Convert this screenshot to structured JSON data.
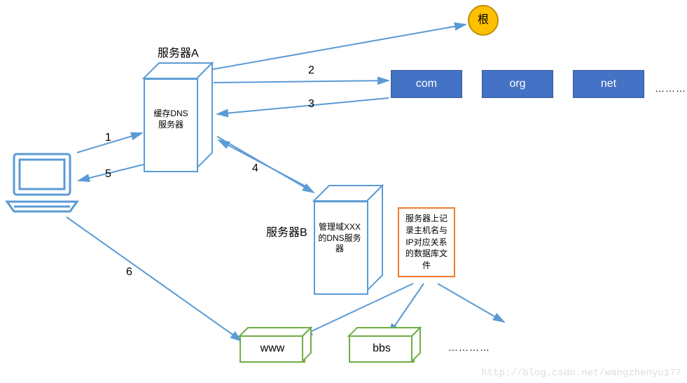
{
  "root": {
    "label": "根"
  },
  "serverA": {
    "title": "服务器A",
    "desc": "缓存DNS\n服务器"
  },
  "serverB": {
    "title": "服务器B",
    "desc": "管理域XXX的DNS服务器"
  },
  "tlds": {
    "com": "com",
    "org": "org",
    "net": "net",
    "more": "…………"
  },
  "note": "服务器上记录主机名与IP对应关系的数据库文件",
  "hosts": {
    "www": "www",
    "bbs": "bbs",
    "more": "…………"
  },
  "edges": {
    "e1": "1",
    "e2": "2",
    "e3": "3",
    "e4": "4",
    "e5": "5",
    "e6": "6"
  },
  "watermark": "http://blog.csdn.net/wangzhenyu177"
}
